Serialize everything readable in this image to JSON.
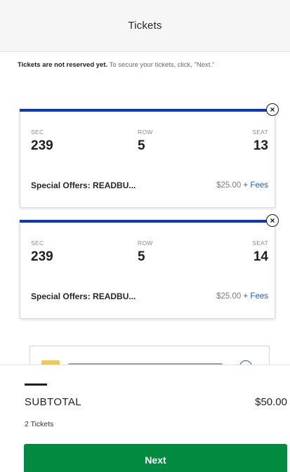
{
  "header": {
    "title": "Tickets"
  },
  "notice": {
    "bold": "Tickets are not reserved yet.",
    "text": " To secure your tickets, click, \"Next.\""
  },
  "labels": {
    "sec": "SEC",
    "row": "ROW",
    "seat": "SEAT",
    "close": "×"
  },
  "tickets": [
    {
      "sec": "239",
      "row": "5",
      "seat": "13",
      "offer": "Special Offers: READBU...",
      "price": "$25.00",
      "fees": " + Fees"
    },
    {
      "sec": "239",
      "row": "5",
      "seat": "14",
      "offer": "Special Offers: READBU...",
      "price": "$25.00",
      "fees": " + Fees"
    }
  ],
  "footer": {
    "subtotal_label": "SUBTOTAL",
    "subtotal_value": "$50.00",
    "ticket_count": "2 Tickets",
    "next_label": "Next"
  },
  "colors": {
    "accent_bar": "#0b35c9",
    "next_button": "#028a41",
    "fees_link": "#1a5bd6"
  },
  "icons": [
    "close-icon",
    "info-icon"
  ]
}
